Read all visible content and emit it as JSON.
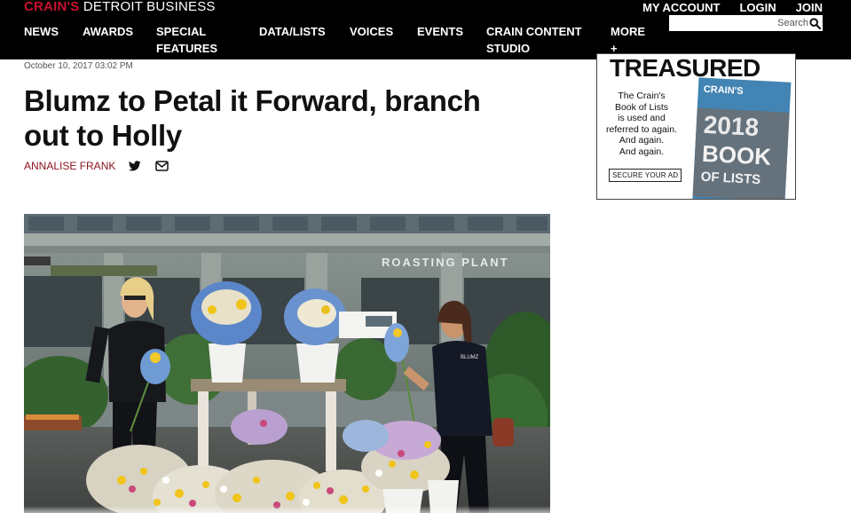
{
  "site": {
    "logo_brand": "CRAIN'S",
    "logo_rest": " DETROIT BUSINESS",
    "account_links": [
      "MY ACCOUNT",
      "LOGIN",
      "JOIN"
    ],
    "search_placeholder": "Search",
    "nav": [
      "NEWS",
      "AWARDS",
      "SPECIAL",
      "FEATURES",
      "DATA/LISTS",
      "VOICES",
      "EVENTS",
      "CRAIN CONTENT",
      "STUDIO",
      "MORE",
      "+"
    ]
  },
  "article": {
    "dateline": "October 10, 2017 03:02 PM",
    "headline": "Blumz to Petal it Forward, branch out to Holly",
    "author": "ANNALISE FRANK",
    "icons": [
      "twitter-icon",
      "email-icon"
    ]
  },
  "photo": {
    "storefront_sign": "ROASTING PLANT",
    "shirt_text": "BLUMZ"
  },
  "ad": {
    "headline": "TREASURED",
    "copy_line1": "The Crain's",
    "copy_line2": "Book of Lists",
    "copy_line3": "is used and",
    "copy_line4": "referred to again.",
    "copy_line5": "And again.",
    "copy_line6": "And again.",
    "cta": "SECURE YOUR AD",
    "book_brand": "CRAIN'S",
    "book_year": "2018",
    "book_title_1": "BOOK",
    "book_title_2": "OF LISTS"
  },
  "colors": {
    "header_bg": "#000000",
    "brand_red": "#c8102e",
    "author_red": "#8a1420"
  }
}
